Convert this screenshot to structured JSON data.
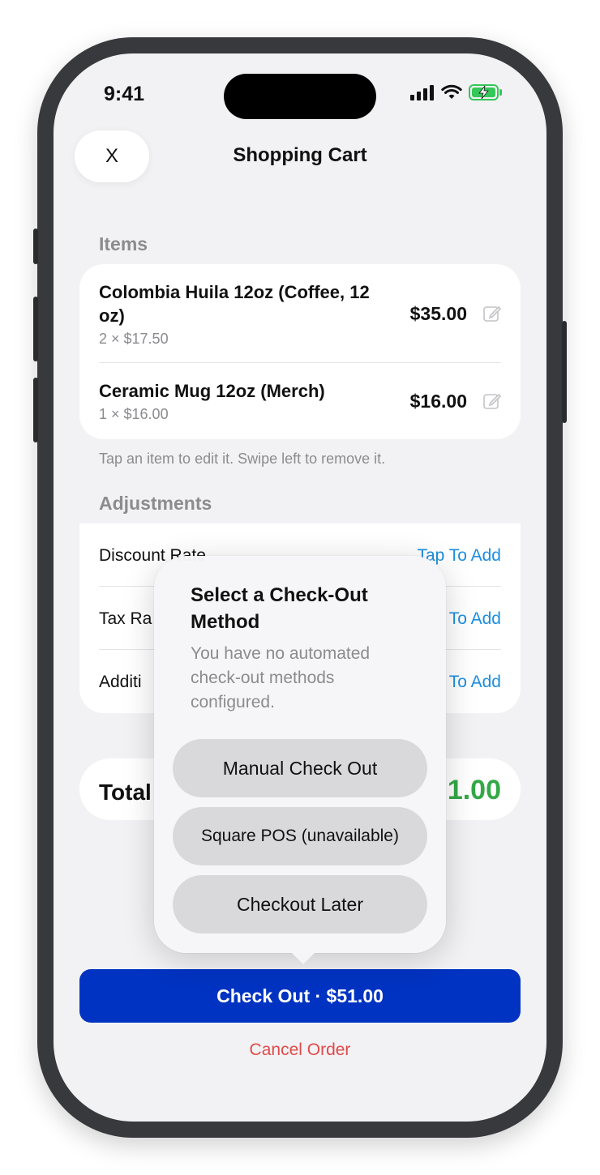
{
  "status_bar": {
    "time": "9:41"
  },
  "nav": {
    "close_label": "X",
    "title": "Shopping Cart"
  },
  "items_section": {
    "header": "Items",
    "items": [
      {
        "name": "Colombia Huila 12oz (Coffee, 12 oz)",
        "detail": "2 × $17.50",
        "price": "$35.00",
        "icon": "edit-icon"
      },
      {
        "name": "Ceramic Mug 12oz (Merch)",
        "detail": "1 × $16.00",
        "price": "$16.00",
        "icon": "edit-icon"
      }
    ],
    "hint": "Tap an item to edit it. Swipe left to remove it."
  },
  "adjustments_section": {
    "header": "Adjustments",
    "rows": [
      {
        "label": "Discount Rate",
        "action": "Tap To Add"
      },
      {
        "label": "Tax Ra",
        "action": "To Add"
      },
      {
        "label": "Additi",
        "action": "To Add"
      }
    ]
  },
  "total": {
    "label": "Total",
    "value": "1.00"
  },
  "popover": {
    "title": "Select a Check-Out Method",
    "message": "You have no automated check-out methods configured.",
    "options": [
      "Manual Check Out",
      "Square POS (unavailable)",
      "Checkout Later"
    ]
  },
  "checkout_button": "Check Out · $51.00",
  "cancel_label": "Cancel Order",
  "colors": {
    "primary": "#0033c2",
    "link": "#1c8ee0",
    "total": "#34a847",
    "danger": "#e04a4a"
  }
}
